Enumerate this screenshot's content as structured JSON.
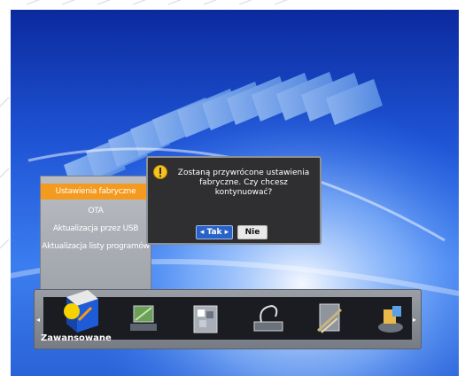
{
  "dialog": {
    "message": "Zostaną przywrócone ustawienia fabryczne. Czy chcesz kontynuować?",
    "yes_label": "◂ Tak ▸",
    "no_label": "Nie",
    "icon": "warning-icon"
  },
  "menu": {
    "items": [
      {
        "label": "Ustawienia fabryczne",
        "selected": true
      },
      {
        "label": "OTA",
        "selected": false
      },
      {
        "label": "Aktualizacja przez USB",
        "selected": false
      },
      {
        "label": "Aktualizacja listy programów",
        "selected": false
      }
    ]
  },
  "tray": {
    "selected_label": "Zawansowane",
    "icons": [
      "advanced-settings-icon",
      "installation-icon",
      "system-icon",
      "media-icon",
      "tools-icon",
      "games-icon"
    ]
  },
  "colors": {
    "highlight": "#f39a1f",
    "button_active": "#2a63c8",
    "dialog_bg": "#2f2f31"
  }
}
